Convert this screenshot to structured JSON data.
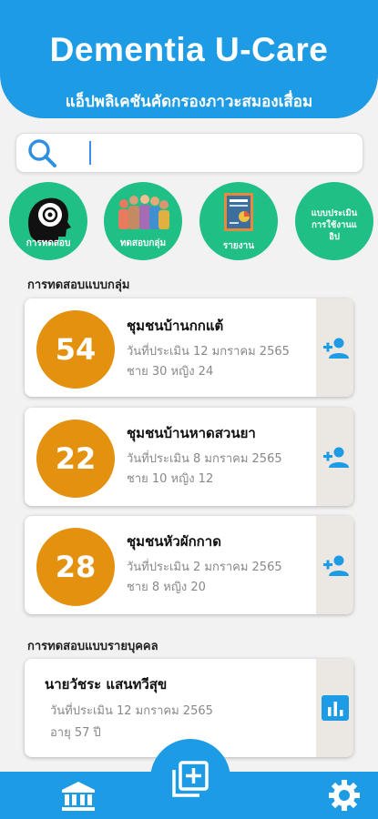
{
  "header": {
    "title": "Dementia U-Care",
    "subtitle": "แอ็ปพลิเคชันคัดกรองภาวะสมองเสื่อม"
  },
  "search": {
    "placeholder": ""
  },
  "categories": [
    {
      "label": "การทดสอบ",
      "icon": "head-brain-icon"
    },
    {
      "label": "ทดสอบกลุ่ม",
      "icon": "group-people-icon"
    },
    {
      "label": "รายงาน",
      "icon": "report-document-icon"
    },
    {
      "label_lines": [
        "แบบประเมิน",
        "การใช้งานแ",
        "อิป"
      ],
      "icon": "none"
    }
  ],
  "group_section": {
    "title": "การทดสอบแบบกลุ่ม",
    "cards": [
      {
        "count": "54",
        "name": "ชุมชนบ้านกกแต้",
        "date": "วันที่ประเมิน 12 มกราคม 2565",
        "gender": "ชาย 30  หญิง 24"
      },
      {
        "count": "22",
        "name": "ชุมชนบ้านหาดสวนยา",
        "date": "วันที่ประเมิน 8 มกราคม 2565",
        "gender": "ชาย 10  หญิง 12"
      },
      {
        "count": "28",
        "name": "ชุมชนหัวผักกาด",
        "date": "วันที่ประเมิน 2 มกราคม 2565",
        "gender": "ชาย 8  หญิง 20"
      }
    ]
  },
  "individual_section": {
    "title": "การทดสอบแบบรายบุคคล",
    "cards": [
      {
        "name": "นายวัชระ แสนทวีสุข",
        "date": "วันที่ประเมิน 12 มกราคม 2565",
        "age": "อายุ 57 ปี"
      }
    ]
  },
  "colors": {
    "primary": "#1e9be5",
    "green": "#1fbf86",
    "orange": "#e3910f"
  }
}
